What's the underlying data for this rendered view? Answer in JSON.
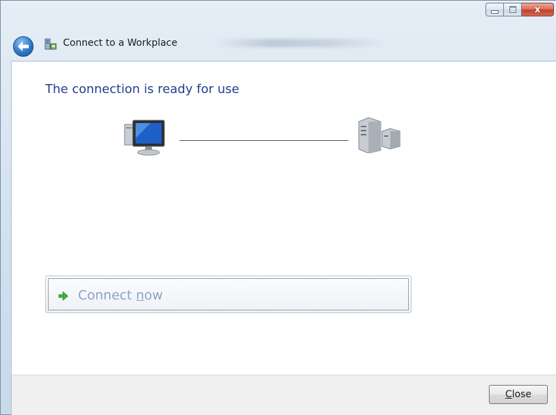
{
  "window": {
    "title": "Connect to a Workplace",
    "controls": {
      "minimize_icon": "minimize-icon",
      "maximize_icon": "maximize-icon",
      "close_glyph": "x"
    }
  },
  "nav": {
    "back_icon": "back-arrow-icon",
    "wizard_icon": "network-workplace-icon"
  },
  "content": {
    "heading": "The connection is ready for use",
    "diagram": {
      "left_icon": "computer-icon",
      "right_icon": "server-icon"
    },
    "command_link": {
      "icon": "green-arrow-icon",
      "label_prefix": "Connect ",
      "label_accel": "n",
      "label_suffix": "ow"
    }
  },
  "footer": {
    "close_accel": "C",
    "close_rest": "lose"
  },
  "colors": {
    "heading": "#1e3e8e",
    "link_text": "#8aa3c5",
    "close_button_red": "#c2412a"
  }
}
